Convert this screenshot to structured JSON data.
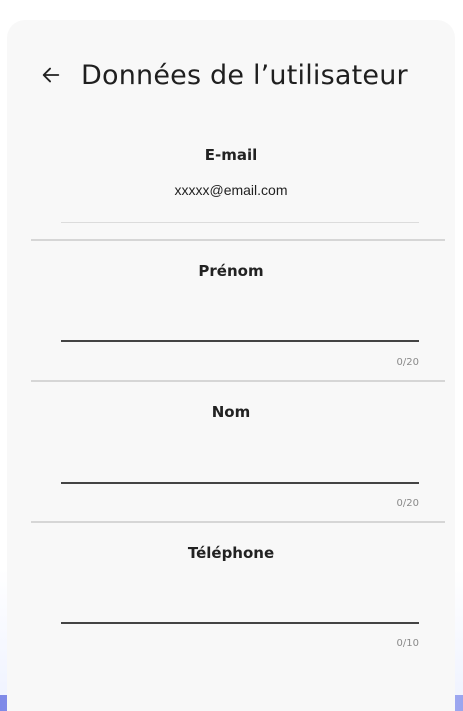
{
  "header": {
    "back_icon": "arrow-left-icon",
    "title": "Données de l’utilisateur"
  },
  "email": {
    "label": "E-mail",
    "value": "xxxxx@email.com"
  },
  "first_name": {
    "label": "Prénom",
    "value": "",
    "counter": "0/20"
  },
  "last_name": {
    "label": "Nom",
    "value": "",
    "counter": "0/20"
  },
  "phone": {
    "label": "Téléphone",
    "value": "",
    "counter": "0/10"
  }
}
